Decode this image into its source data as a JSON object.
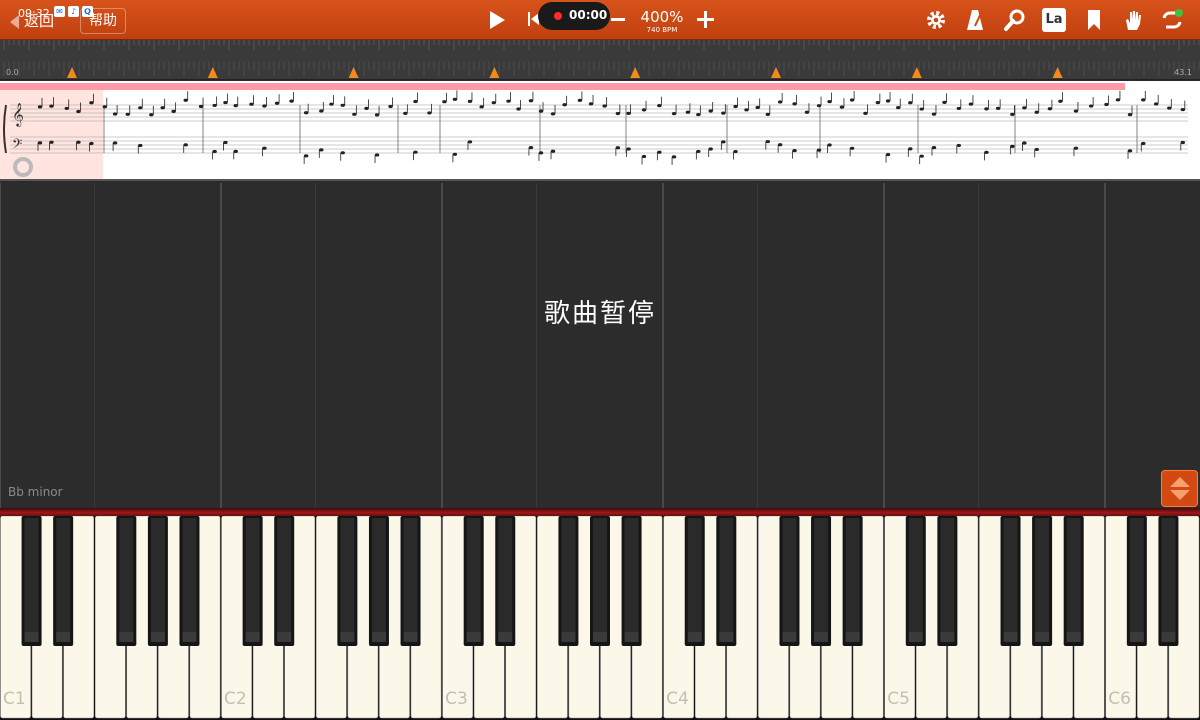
{
  "status_bar": {
    "time": "09:32"
  },
  "toolbar": {
    "back_label": "返回",
    "help_label": "帮助",
    "record_time": "00:00",
    "tempo_percent": "400%",
    "tempo_bpm": "740 BPM",
    "lyrics_button_label": "La",
    "icons": [
      "settings-gear-icon",
      "metronome-icon",
      "zoom-icon",
      "lyrics-icon",
      "bookmark-icon",
      "hand-mode-icon",
      "loop-icon"
    ]
  },
  "timeline": {
    "start_label": "0.0",
    "end_label": "43.1",
    "marker_count": 8,
    "marker_color": "#f08a1a"
  },
  "score": {
    "highlight_color": "#ff9aa8",
    "key_signature": "Bb minor (5 flats)"
  },
  "lane": {
    "paused_text": "歌曲暂停",
    "key_label": "Bb minor"
  },
  "keyboard": {
    "octave_labels": [
      "C1",
      "C2",
      "C3",
      "C4",
      "C5",
      "C6"
    ]
  },
  "colors": {
    "toolbar": "#c84a12",
    "accent": "#d24a12"
  }
}
